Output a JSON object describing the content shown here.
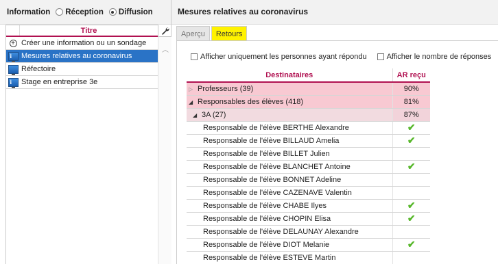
{
  "left": {
    "header_label": "Information",
    "radio_reception": "Réception",
    "radio_diffusion": "Diffusion",
    "list_header": "Titre",
    "items": [
      {
        "label": "Créer une information ou un sondage",
        "icon": "plus-circle-icon"
      },
      {
        "label": "Mesures relatives au coronavirus",
        "icon": "info-monitor-icon",
        "selected": true
      },
      {
        "label": "Réfectoire",
        "icon": "monitor-icon"
      },
      {
        "label": "Stage en entreprise 3e",
        "icon": "info-monitor-icon"
      }
    ]
  },
  "right": {
    "title": "Mesures relatives au coronavirus",
    "tabs": [
      {
        "label": "Aperçu",
        "active": false
      },
      {
        "label": "Retours",
        "active": true
      }
    ],
    "options": {
      "only_responded": "Afficher uniquement les personnes ayant répondu",
      "show_count": "Afficher le nombre de réponses"
    },
    "table": {
      "col_recipients": "Destinataires",
      "col_ar": "AR reçu",
      "groups": [
        {
          "label": "Professeurs (39)",
          "pct": "90%",
          "expanded": false
        },
        {
          "label": "Responsables des élèves (418)",
          "pct": "81%",
          "expanded": true
        },
        {
          "label": "3A (27)",
          "pct": "87%",
          "expanded": true
        }
      ],
      "rows": [
        {
          "label": "Responsable de l'élève BERTHE Alexandre",
          "ack": true
        },
        {
          "label": "Responsable de l'élève BILLAUD Amelia",
          "ack": true
        },
        {
          "label": "Responsable de l'élève BILLET Julien",
          "ack": false
        },
        {
          "label": "Responsable de l'élève BLANCHET Antoine",
          "ack": true
        },
        {
          "label": "Responsable de l'élève BONNET Adeline",
          "ack": false
        },
        {
          "label": "Responsable de l'élève CAZENAVE Valentin",
          "ack": false
        },
        {
          "label": "Responsable de l'élève CHABE Ilyes",
          "ack": true
        },
        {
          "label": "Responsable de l'élève CHOPIN Elisa",
          "ack": true
        },
        {
          "label": "Responsable de l'élève DELAUNAY Alexandre",
          "ack": false
        },
        {
          "label": "Responsable de l'élève DIOT Melanie",
          "ack": true
        },
        {
          "label": "Responsable de l'élève ESTEVE Martin",
          "ack": false
        }
      ]
    }
  },
  "colors": {
    "accent": "#b01050",
    "selection": "#2a73c6",
    "active_tab": "#fff200",
    "check": "#58b82c",
    "group_bg": "#f8c9d2"
  }
}
